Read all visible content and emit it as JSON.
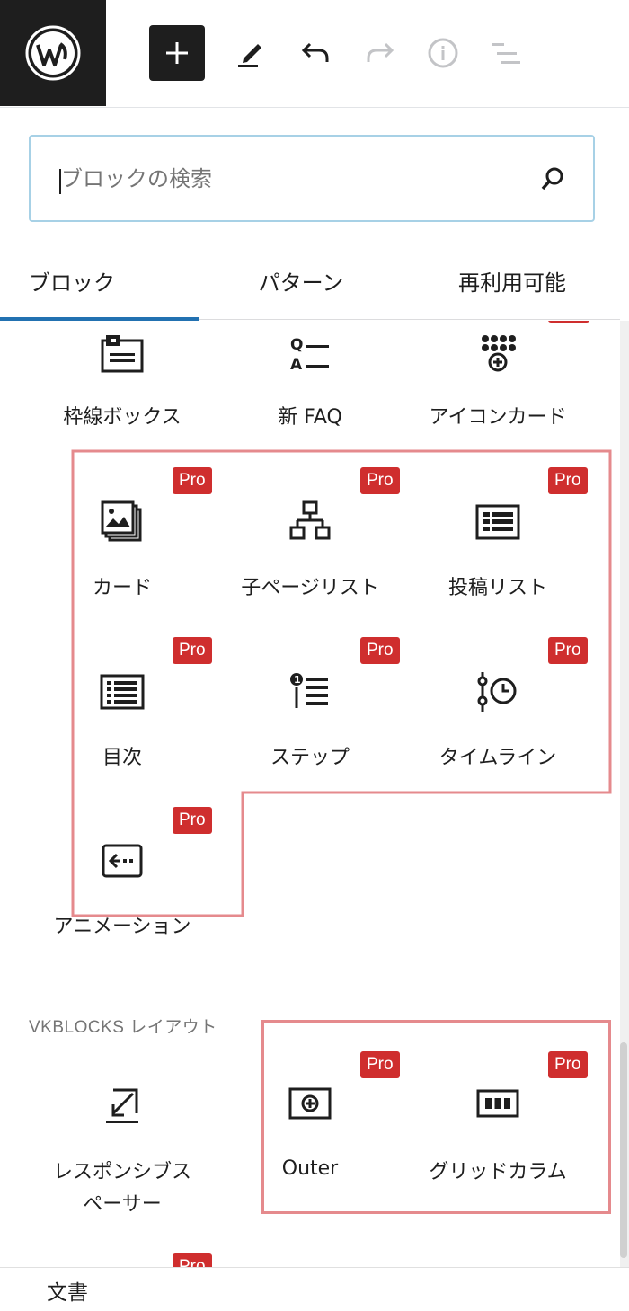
{
  "toolbar": {
    "logo": "wordpress-logo",
    "buttons": [
      "add-block",
      "edit-tool",
      "undo",
      "redo",
      "details-info",
      "list-view"
    ]
  },
  "search": {
    "placeholder": "ブロックの検索"
  },
  "tabs": [
    {
      "label": "ブロック",
      "active": true
    },
    {
      "label": "パターン",
      "active": false
    },
    {
      "label": "再利用可能",
      "active": false
    }
  ],
  "blocks": {
    "row0": [
      {
        "label": "枠線ボックス",
        "icon": "border-box-icon"
      },
      {
        "label": "新 FAQ",
        "icon": "faq-icon"
      },
      {
        "label": "アイコンカード",
        "icon": "icon-card-icon"
      }
    ],
    "pro_group": [
      {
        "label": "カード",
        "icon": "card-icon",
        "badge": "Pro"
      },
      {
        "label": "子ページリスト",
        "icon": "child-page-icon",
        "badge": "Pro"
      },
      {
        "label": "投稿リスト",
        "icon": "post-list-icon",
        "badge": "Pro"
      },
      {
        "label": "目次",
        "icon": "toc-icon",
        "badge": "Pro"
      },
      {
        "label": "ステップ",
        "icon": "step-icon",
        "badge": "Pro"
      },
      {
        "label": "タイムライン",
        "icon": "timeline-icon",
        "badge": "Pro"
      },
      {
        "label": "アニメーション",
        "icon": "animation-icon",
        "badge": "Pro"
      }
    ],
    "layout_section_title": "VKBLOCKS レイアウト",
    "layout": [
      {
        "label": "レスポンシブス\nペーサー",
        "label_line1": "レスポンシブス",
        "label_line2": "ペーサー",
        "icon": "spacer-icon"
      },
      {
        "label": "Outer",
        "icon": "outer-icon",
        "badge": "Pro"
      },
      {
        "label": "グリッドカラム",
        "icon": "grid-column-icon",
        "badge": "Pro"
      }
    ],
    "partial_badge": "Pro"
  },
  "bottom": {
    "label": "文書"
  },
  "colors": {
    "pro_badge": "#cf2e2e",
    "highlight": "#e58a8d",
    "tab_active": "#2271b1",
    "search_border": "#a7d1e6"
  }
}
